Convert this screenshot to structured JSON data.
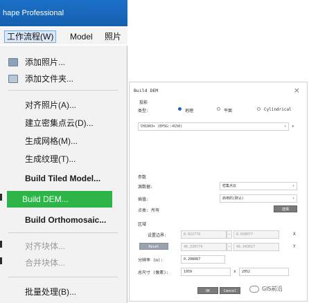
{
  "app": {
    "title": "hape Professional"
  },
  "menubar": {
    "workflow": "工作流程(W)",
    "model": "Model",
    "photos": "照片"
  },
  "dropdown": {
    "items": [
      {
        "label": "添加照片...",
        "state": "normal"
      },
      {
        "label": "添加文件夹...",
        "state": "normal"
      },
      {
        "label": "对齐照片(A)...",
        "state": "normal"
      },
      {
        "label": "建立密集点云(D)...",
        "state": "normal"
      },
      {
        "label": "生成网格(M)...",
        "state": "normal"
      },
      {
        "label": "生成纹理(T)...",
        "state": "normal"
      },
      {
        "label": "Build Tiled Model...",
        "state": "bold"
      },
      {
        "label": "Build DEM...",
        "state": "highlight"
      },
      {
        "label": "Build Orthomosaic...",
        "state": "bold"
      },
      {
        "label": "对齐块体...",
        "state": "disabled"
      },
      {
        "label": "合并块体...",
        "state": "disabled"
      },
      {
        "label": "批量处理(B)...",
        "state": "normal"
      }
    ]
  },
  "dialog": {
    "title": "Build DEM",
    "projection": {
      "section": "投影",
      "type_label": "类型:",
      "options": [
        "地理",
        "平面",
        "Cylindrical"
      ],
      "selected": "地理",
      "crs_value": "CH1903+ (EPSG::4150)"
    },
    "params": {
      "section": "参数",
      "source_label": "源数据:",
      "source_value": "密集点云",
      "interpolation_label": "插值:",
      "interpolation_value": "启用的(默认)",
      "points_label": "点类: 所有",
      "select_button": "选择"
    },
    "region": {
      "section": "区域",
      "setup_label": "设置边界:",
      "x_min": "8.022779",
      "x_max": "8.028077",
      "x_axis": "X",
      "reset_button": "Reset",
      "y_min": "46.339774",
      "y_max": "46.343617",
      "y_axis": "Y",
      "resolution_label": "分辨率 (m):",
      "resolution_value": "0.208087",
      "total_size_label": "总尺寸 (像素):",
      "width_value": "1959",
      "times": "x",
      "height_value": "2052"
    },
    "ok_button": "OK",
    "cancel_button": "Cancel"
  },
  "watermark": {
    "text": "GIS前沿"
  },
  "colors": {
    "title_bar": "#1b6fc7",
    "highlight": "#2fb44a",
    "selected_radio": "#1e63c8"
  }
}
